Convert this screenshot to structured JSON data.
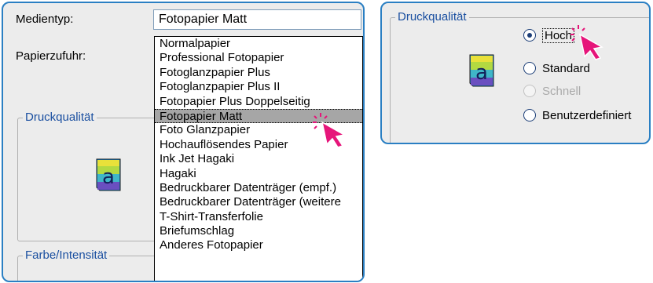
{
  "left_panel": {
    "media_type_label": "Medientyp:",
    "paper_feed_label": "Papierzufuhr:",
    "selected_value": "Fotopapier Matt",
    "options": [
      "Normalpapier",
      "Professional Fotopapier",
      "Fotoglanzpapier Plus",
      "Fotoglanzpapier Plus II",
      "Fotopapier Plus Doppelseitig",
      "Fotopapier Matt",
      "Foto Glanzpapier",
      "Hochauflösendes Papier",
      "Ink Jet Hagaki",
      "Hagaki",
      "Bedruckbarer Datenträger (empf.)",
      "Bedruckbarer Datenträger (weitere",
      "T-Shirt-Transferfolie",
      "Briefumschlag",
      "Anderes Fotopapier"
    ],
    "selected_index": 5,
    "quality_group_title": "Druckqualität",
    "color_group_title": "Farbe/Intensität"
  },
  "right_panel": {
    "group_title": "Druckqualität",
    "radios": [
      {
        "label": "Hoch",
        "checked": true,
        "disabled": false
      },
      {
        "label": "Standard",
        "checked": false,
        "disabled": false
      },
      {
        "label": "Schnell",
        "checked": false,
        "disabled": true
      },
      {
        "label": "Benutzerdefiniert",
        "checked": false,
        "disabled": false
      }
    ]
  },
  "icon_letter": "a",
  "colors": {
    "panel_border": "#2a7fc3",
    "cursor": "#e6157a",
    "selection": "#a6a6a6"
  }
}
